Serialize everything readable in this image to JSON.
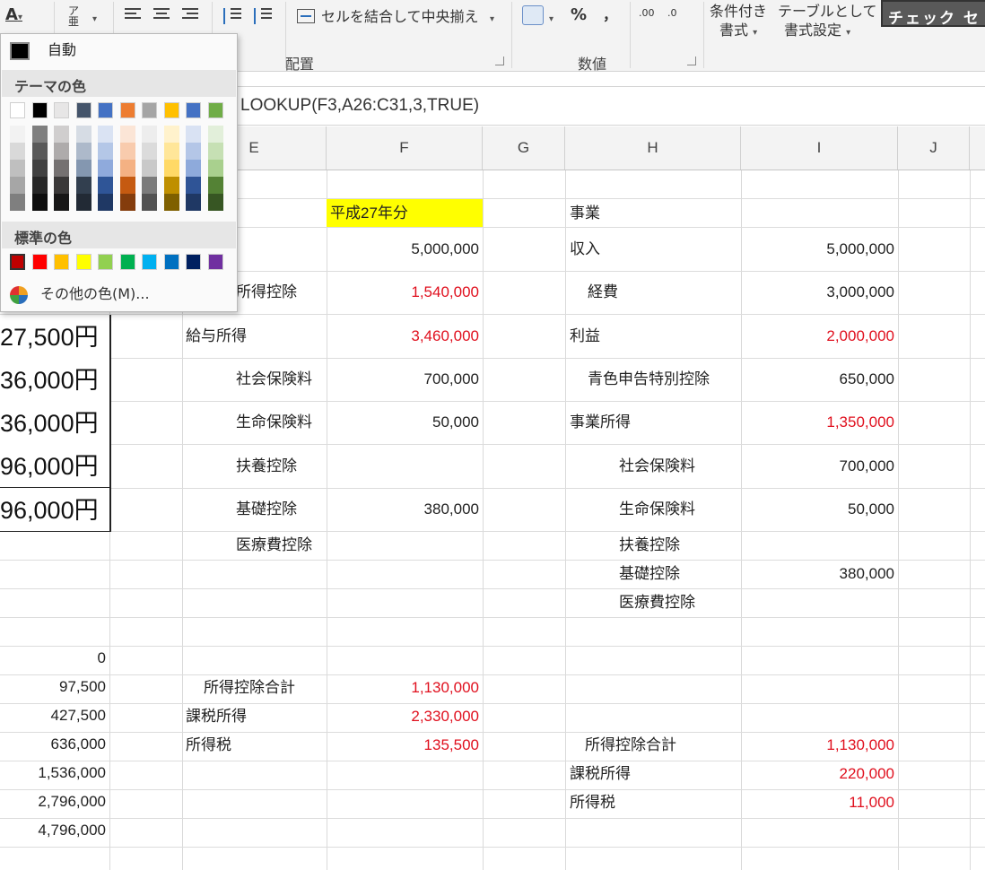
{
  "ribbon": {
    "merge_center_label": "セルを結合して中央揃え",
    "percent_label": "%",
    "comma_label": "，",
    "decimal_up_label": ".00",
    "decimal_down_label": ".0",
    "conditional_format_label_1": "条件付き",
    "conditional_format_label_2": "書式",
    "table_format_label_1": "テーブルとして",
    "table_format_label_2": "書式設定",
    "cell_style_label": "チェック セ",
    "group_alignment": "配置",
    "group_number": "数値",
    "caret": "▾"
  },
  "formula": "LOOKUP(F3,A26:C31,3,TRUE)",
  "columns": [
    "E",
    "F",
    "G",
    "H",
    "I",
    "J"
  ],
  "dropdown": {
    "auto_label": "自動",
    "theme_label": "テーマの色",
    "standard_label": "標準の色",
    "more_colors_label": "その他の色(M)...",
    "theme_colors": [
      [
        "#ffffff",
        "#000000",
        "#e7e6e6",
        "#44546a",
        "#4472c4",
        "#ed7d31",
        "#a5a5a5",
        "#ffc000",
        "#4472c4",
        "#70ad47"
      ],
      [
        "#f2f2f2",
        "#7f7f7f",
        "#d0cece",
        "#d6dce4",
        "#dae3f3",
        "#fbe5d6",
        "#ededed",
        "#fff2cc",
        "#d9e2f3",
        "#e2efda"
      ],
      [
        "#d9d9d9",
        "#595959",
        "#aeabab",
        "#adb9ca",
        "#b4c7e7",
        "#f8cbad",
        "#dbdbdb",
        "#ffe699",
        "#b4c6e7",
        "#c6e0b4"
      ],
      [
        "#bfbfbf",
        "#404040",
        "#757171",
        "#8497b0",
        "#8faadc",
        "#f4b183",
        "#c9c9c9",
        "#ffd966",
        "#8eaadb",
        "#a9d08e"
      ],
      [
        "#a6a6a6",
        "#262626",
        "#3a3838",
        "#323f4f",
        "#2f5597",
        "#c55a11",
        "#7b7b7b",
        "#bf8f00",
        "#2f5496",
        "#548235"
      ],
      [
        "#7f7f7f",
        "#0d0d0d",
        "#171616",
        "#222a35",
        "#1f3864",
        "#843c0c",
        "#525252",
        "#7f6000",
        "#1f3864",
        "#375623"
      ]
    ],
    "standard_colors": [
      "#c00000",
      "#ff0000",
      "#ffc000",
      "#ffff00",
      "#92d050",
      "#00b050",
      "#00b0f0",
      "#0070c0",
      "#002060",
      "#7030a0"
    ]
  },
  "left_big_values": [
    "27,500円",
    "36,000円",
    "36,000円",
    "96,000円",
    "96,000円"
  ],
  "left_small_values": [
    "0",
    "97,500",
    "427,500",
    "636,000",
    "1,536,000",
    "2,796,000",
    "4,796,000"
  ],
  "cells": {
    "e_shotoku_koujo": "所得控除",
    "f_heisei": "平成27年分",
    "f_income": "5,000,000",
    "f_koujo": "1,540,000",
    "e_kyuyo": "給与所得",
    "f_kyuyo": "3,460,000",
    "e_shakai": "社会保険料",
    "f_shakai": "700,000",
    "e_seimei": "生命保険料",
    "f_seimei": "50,000",
    "e_fuyou": "扶養控除",
    "e_kiso": "基礎控除",
    "f_kiso": "380,000",
    "e_iryo": "医療費控除",
    "e_koujo_total": "所得控除合計",
    "f_koujo_total": "1,130,000",
    "e_kazei": "課税所得",
    "f_kazei": "2,330,000",
    "e_shotokuzei": "所得税",
    "f_shotokuzei": "135,500",
    "h_jigyo": "事業",
    "h_shunyu": "収入",
    "i_shunyu": "5,000,000",
    "h_keihi": "経費",
    "i_keihi": "3,000,000",
    "h_rieki": "利益",
    "i_rieki": "2,000,000",
    "h_aoiro": "青色申告特別控除",
    "i_aoiro": "650,000",
    "h_jigyo_shotoku": "事業所得",
    "i_jigyo_shotoku": "1,350,000",
    "h_shakai": "社会保険料",
    "i_shakai": "700,000",
    "h_seimei": "生命保険料",
    "i_seimei": "50,000",
    "h_fuyou": "扶養控除",
    "h_kiso": "基礎控除",
    "i_kiso": "380,000",
    "h_iryo": "医療費控除",
    "h_koujo_total": "所得控除合計",
    "i_koujo_total": "1,130,000",
    "h_kazei": "課税所得",
    "i_kazei": "220,000",
    "h_shotokuzei": "所得税",
    "i_shotokuzei": "11,000"
  }
}
